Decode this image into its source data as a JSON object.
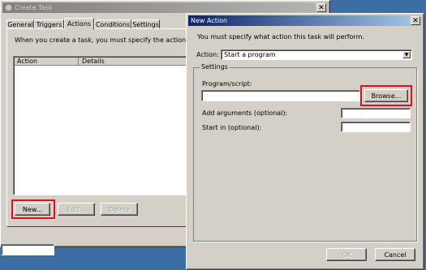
{
  "create_task": {
    "title": "Create Task",
    "tabs": [
      "General",
      "Triggers",
      "Actions",
      "Conditions",
      "Settings"
    ],
    "description": "When you create a task, you must specify the action that will o",
    "columns": [
      "Action",
      "Details"
    ],
    "new_button": "New...",
    "edit_button": "Edit...",
    "delete_button": "Delete"
  },
  "new_action": {
    "title": "New Action",
    "description": "You must specify what action this task will perform.",
    "action_label": "Action:",
    "action_value": "Start a program",
    "settings_label": "Settings",
    "program_label": "Program/script:",
    "program_value": "",
    "browse_button": "Browse...",
    "arguments_label": "Add arguments (optional):",
    "arguments_value": "",
    "start_in_label": "Start in (optional):",
    "start_in_value": "",
    "ok_button": "OK",
    "cancel_button": "Cancel"
  }
}
